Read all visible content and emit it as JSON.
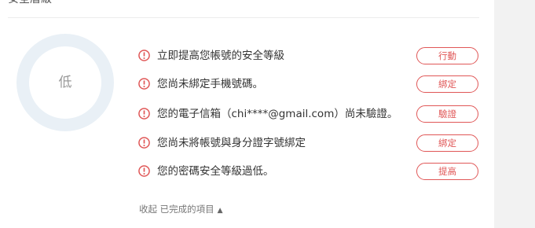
{
  "section": {
    "title": "安全層級"
  },
  "security_level": {
    "label": "低",
    "ring_color": "#e9f0f6"
  },
  "accent_color": "#e05757",
  "tasks": [
    {
      "icon": "alert-icon",
      "text": "立即提高您帳號的安全等級",
      "action": "行動"
    },
    {
      "icon": "alert-icon",
      "text": "您尚未綁定手機號碼。",
      "action": "綁定"
    },
    {
      "icon": "alert-icon",
      "text": "您的電子信箱（chi****@gmail.com）尚未驗證。",
      "action": "驗證"
    },
    {
      "icon": "alert-icon",
      "text": "您尚未將帳號與身分證字號綁定",
      "action": "綁定"
    },
    {
      "icon": "alert-icon",
      "text": "您的密碼安全等級過低。",
      "action": "提高"
    }
  ],
  "collapse": {
    "label": "收起 已完成的項目",
    "caret_icon": "caret-up-icon"
  }
}
